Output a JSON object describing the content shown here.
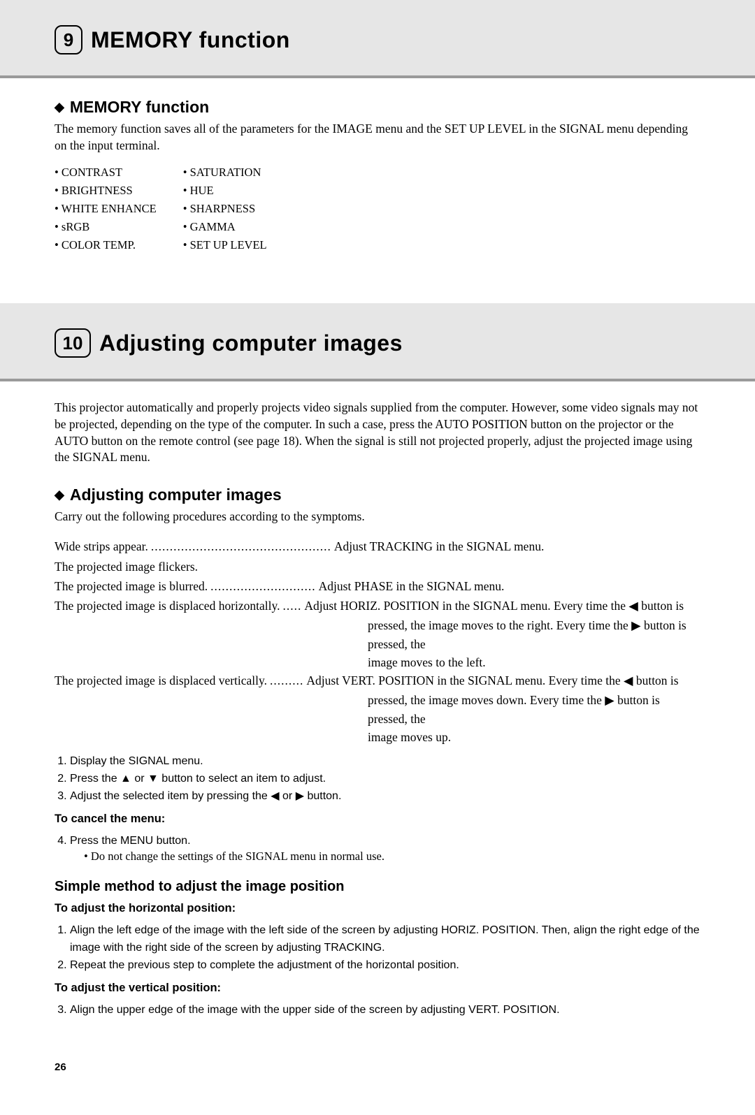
{
  "section9": {
    "number": "9",
    "title": "MEMORY function",
    "sub_title": "MEMORY function",
    "intro": "The memory function saves all of the parameters for the IMAGE menu and the SET UP LEVEL in the SIGNAL menu depending on the input terminal.",
    "params_col1": [
      "CONTRAST",
      "BRIGHTNESS",
      "WHITE ENHANCE",
      "sRGB",
      "COLOR TEMP."
    ],
    "params_col2": [
      "SATURATION",
      "HUE",
      "SHARPNESS",
      "GAMMA",
      "SET UP LEVEL"
    ]
  },
  "section10": {
    "number": "10",
    "title": "Adjusting computer images",
    "intro": "This projector automatically and properly projects video signals supplied from the computer. However, some video signals may not be projected, depending on the type of the computer. In such a case, press the AUTO POSITION button on the projector or the AUTO button on the remote control (see page 18). When the signal is still not projected properly, adjust the projected image using the SIGNAL menu.",
    "sub_title": "Adjusting computer images",
    "lead": "Carry out the following procedures according to the symptoms.",
    "symptoms": {
      "s1_label": "Wide strips appear.",
      "s1_dots": "................................................",
      "s1_fix": "Adjust TRACKING in the SIGNAL menu.",
      "s2_label": "The projected image flickers.",
      "s3_label": "The projected image is blurred.",
      "s3_dots": " ............................",
      "s3_fix": "Adjust PHASE in the SIGNAL menu.",
      "s4_label": "The projected image is displaced horizontally.",
      "s4_dots": ".....",
      "s4_fix_a": "Adjust HORIZ. POSITION in the SIGNAL menu. Every time the ",
      "s4_fix_b": " button is",
      "s4_fix_line2a": "pressed, the image moves to the right. Every time the ",
      "s4_fix_line2b": " button is pressed, the",
      "s4_fix_line3": "image moves to the left.",
      "s5_label": "The projected image is displaced vertically.",
      "s5_dots": ".........",
      "s5_fix_a": "Adjust VERT. POSITION in the SIGNAL menu. Every time the ",
      "s5_fix_b": " button is",
      "s5_fix_line2a": "pressed, the image moves down. Every time the ",
      "s5_fix_line2b": " button is pressed, the",
      "s5_fix_line3": "image moves up."
    },
    "steps": {
      "s1": "Display the SIGNAL menu.",
      "s2a": "Press the ",
      "s2b": " or ",
      "s2c": " button to select an item to adjust.",
      "s3a": "Adjust the selected item by pressing the ",
      "s3b": " or ",
      "s3c": " button."
    },
    "cancel_head": "To cancel the menu:",
    "step4": "Press the MENU button.",
    "note": "Do not change the settings of the SIGNAL menu in normal use.",
    "simple_head": "Simple method to adjust the image position",
    "horiz_head": "To adjust the horizontal position:",
    "h_step1": "Align the left edge of the image with the left side of the screen by adjusting HORIZ. POSITION. Then, align the right edge of the image with the right side of the screen by adjusting TRACKING.",
    "h_step2": "Repeat the previous step to complete the adjustment of the horizontal position.",
    "vert_head": "To adjust the vertical position:",
    "v_step3": "Align the upper edge of the image with the upper side of the screen by adjusting VERT. POSITION."
  },
  "glyphs": {
    "diamond": "◆",
    "left": "◀",
    "right": "▶",
    "up": "▲",
    "down": "▼"
  },
  "page_number": "26"
}
